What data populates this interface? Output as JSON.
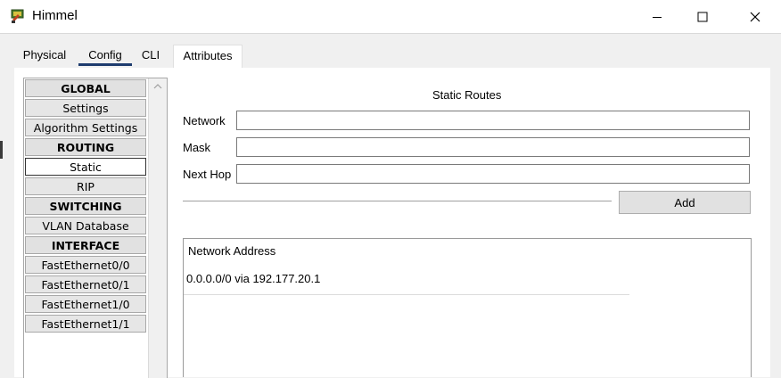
{
  "window": {
    "title": "Himmel",
    "icon": "router-device-icon",
    "controls": [
      "minimize-icon",
      "maximize-icon",
      "close-icon"
    ]
  },
  "tabs": [
    {
      "label": "Physical",
      "active": false
    },
    {
      "label": "Config",
      "active": true
    },
    {
      "label": "CLI",
      "active": false
    },
    {
      "label": "Attributes",
      "active": false
    }
  ],
  "sidebar": {
    "items": [
      {
        "label": "GLOBAL",
        "header": true
      },
      {
        "label": "Settings"
      },
      {
        "label": "Algorithm Settings"
      },
      {
        "label": "ROUTING",
        "header": true
      },
      {
        "label": "Static",
        "selected": true
      },
      {
        "label": "RIP"
      },
      {
        "label": "SWITCHING",
        "header": true
      },
      {
        "label": "VLAN Database"
      },
      {
        "label": "INTERFACE",
        "header": true
      },
      {
        "label": "FastEthernet0/0"
      },
      {
        "label": "FastEthernet0/1"
      },
      {
        "label": "FastEthernet1/0"
      },
      {
        "label": "FastEthernet1/1"
      }
    ]
  },
  "static_routes": {
    "title": "Static Routes",
    "network_label": "Network",
    "network_value": "",
    "mask_label": "Mask",
    "mask_value": "",
    "next_hop_label": "Next Hop",
    "next_hop_value": "",
    "add_label": "Add",
    "table_header": "Network Address",
    "routes": [
      "0.0.0.0/0 via 192.177.20.1"
    ]
  }
}
